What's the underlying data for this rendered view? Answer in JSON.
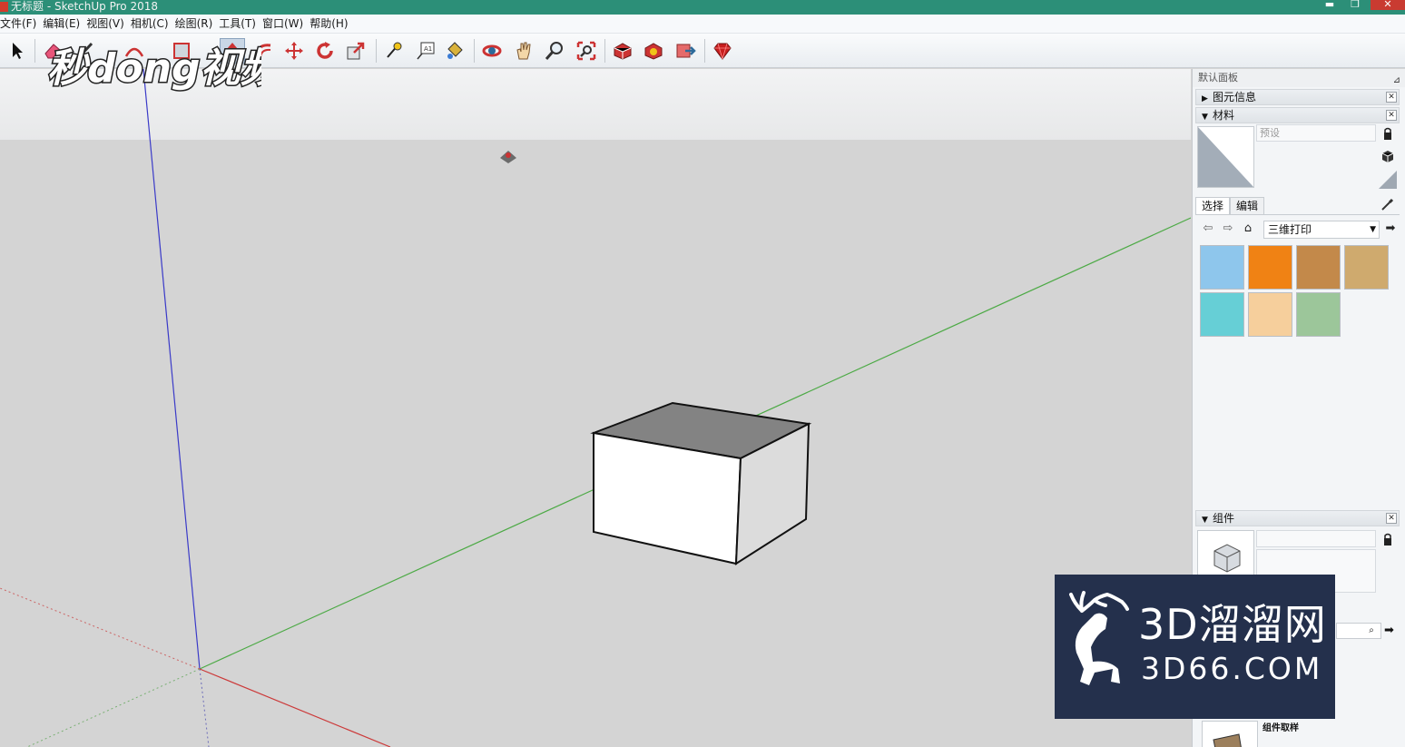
{
  "window": {
    "title": "无标题 - SketchUp Pro 2018",
    "min_label": "▬",
    "max_label": "❐",
    "close_label": "✕"
  },
  "menu": [
    "文件(F)",
    "编辑(E)",
    "视图(V)",
    "相机(C)",
    "绘图(R)",
    "工具(T)",
    "窗口(W)",
    "帮助(H)"
  ],
  "toolbar": {
    "tools": [
      "select",
      "eraser",
      "line",
      "arc",
      "rectangle",
      "push-pull",
      "offset",
      "move",
      "rotate",
      "scale",
      "tape-measure",
      "text",
      "paint-bucket",
      "orbit",
      "pan",
      "zoom",
      "zoom-extents",
      "3d-warehouse",
      "extension-warehouse",
      "send-to-layout",
      "ruby-console"
    ]
  },
  "watermarks": {
    "qiudong": "秒dong视频",
    "brand_line1": "3D溜溜网",
    "brand_line2": "3D66.COM"
  },
  "tray": {
    "title": "默认面板",
    "entity_info_label": "图元信息",
    "materials": {
      "label": "材料",
      "name_placeholder": "预设",
      "tabs": [
        "选择",
        "编辑"
      ],
      "library": "三维打印",
      "swatches": [
        "#8ec6ec",
        "#f08214",
        "#c3894a",
        "#cfaa6e",
        "#66cfd6",
        "#f6cf9c",
        "#9cc69a"
      ]
    },
    "components": {
      "label": "组件",
      "sample_label": "组件取样"
    }
  },
  "colors": {
    "title_bar": "#2c8f78",
    "axis_red": "#cc3a3a",
    "axis_green": "#4daa46",
    "axis_blue": "#3a3ac8",
    "sky": "#eeeff0",
    "ground": "#d4d4d4",
    "brand_bg": "#24304c"
  }
}
